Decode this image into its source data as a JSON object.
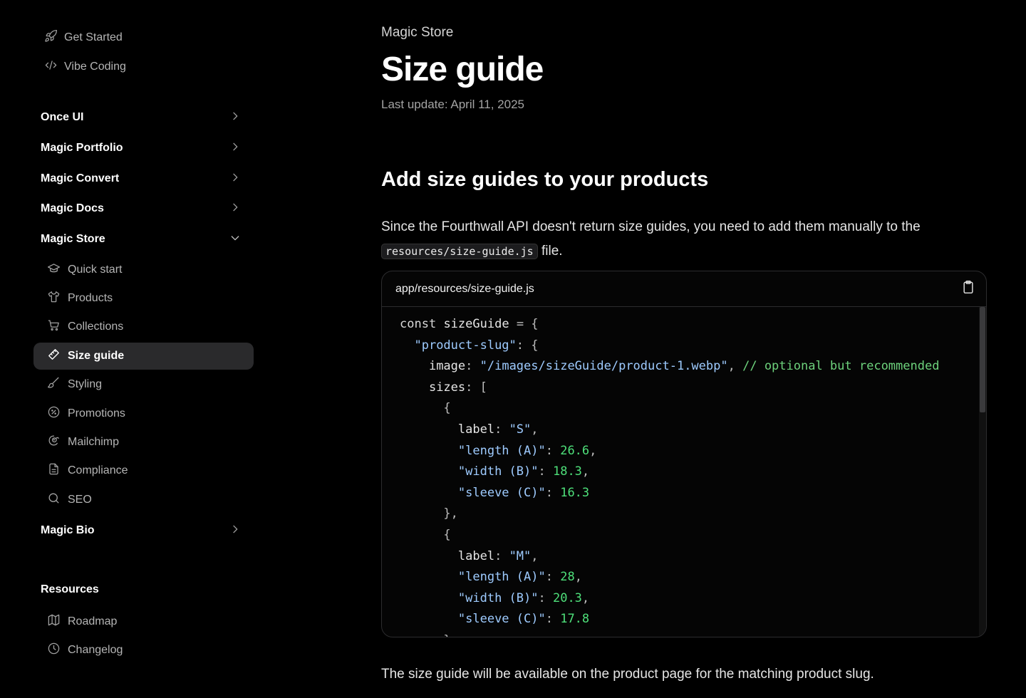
{
  "sidebar": {
    "top_links": [
      {
        "label": "Get Started",
        "icon": "rocket-icon"
      },
      {
        "label": "Vibe Coding",
        "icon": "code-icon"
      }
    ],
    "groups": [
      {
        "label": "Once UI",
        "expanded": false
      },
      {
        "label": "Magic Portfolio",
        "expanded": false
      },
      {
        "label": "Magic Convert",
        "expanded": false
      },
      {
        "label": "Magic Docs",
        "expanded": false
      },
      {
        "label": "Magic Store",
        "expanded": true
      },
      {
        "label": "Magic Bio",
        "expanded": false
      }
    ],
    "store_items": [
      {
        "label": "Quick start",
        "icon": "graduation-cap-icon"
      },
      {
        "label": "Products",
        "icon": "tshirt-icon"
      },
      {
        "label": "Collections",
        "icon": "cart-icon"
      },
      {
        "label": "Size guide",
        "icon": "ruler-icon",
        "active": true
      },
      {
        "label": "Styling",
        "icon": "brush-icon"
      },
      {
        "label": "Promotions",
        "icon": "discount-icon"
      },
      {
        "label": "Mailchimp",
        "icon": "mailchimp-icon"
      },
      {
        "label": "Compliance",
        "icon": "document-icon"
      },
      {
        "label": "SEO",
        "icon": "search-icon"
      }
    ],
    "resources_label": "Resources",
    "resources": [
      {
        "label": "Roadmap",
        "icon": "map-icon"
      },
      {
        "label": "Changelog",
        "icon": "clock-icon"
      }
    ]
  },
  "main": {
    "eyebrow": "Magic Store",
    "title": "Size guide",
    "last_update": "Last update: April 11, 2025",
    "heading": "Add size guides to your products",
    "paragraph_before": "Since the Fourthwall API doesn't return size guides, you need to add them manually to the",
    "paragraph_code": "resources/size-guide.js",
    "paragraph_after": " file.",
    "code_filename": "app/resources/size-guide.js",
    "code": {
      "const_kw": "const",
      "var_name": "sizeGuide",
      "slug": "\"product-slug\"",
      "image_key": "image",
      "image_value": "\"/images/sizeGuide/product-1.webp\"",
      "comment": "// optional but recommended",
      "sizes_key": "sizes",
      "label_key": "label",
      "s_label": "\"S\"",
      "m_label": "\"M\"",
      "length_key": "\"length (A)\"",
      "width_key": "\"width (B)\"",
      "sleeve_key": "\"sleeve (C)\"",
      "s_length": "26.6",
      "s_width": "18.3",
      "s_sleeve": "16.3",
      "m_length": "28",
      "m_width": "20.3",
      "m_sleeve": "17.8"
    },
    "footer": "The size guide will be available on the product page for the matching product slug."
  },
  "colors": {
    "background": "#000000",
    "active_bg": "#2a2a2c",
    "string": "#9ecbff",
    "number": "#4ee07a",
    "comment": "#6dd27c"
  }
}
